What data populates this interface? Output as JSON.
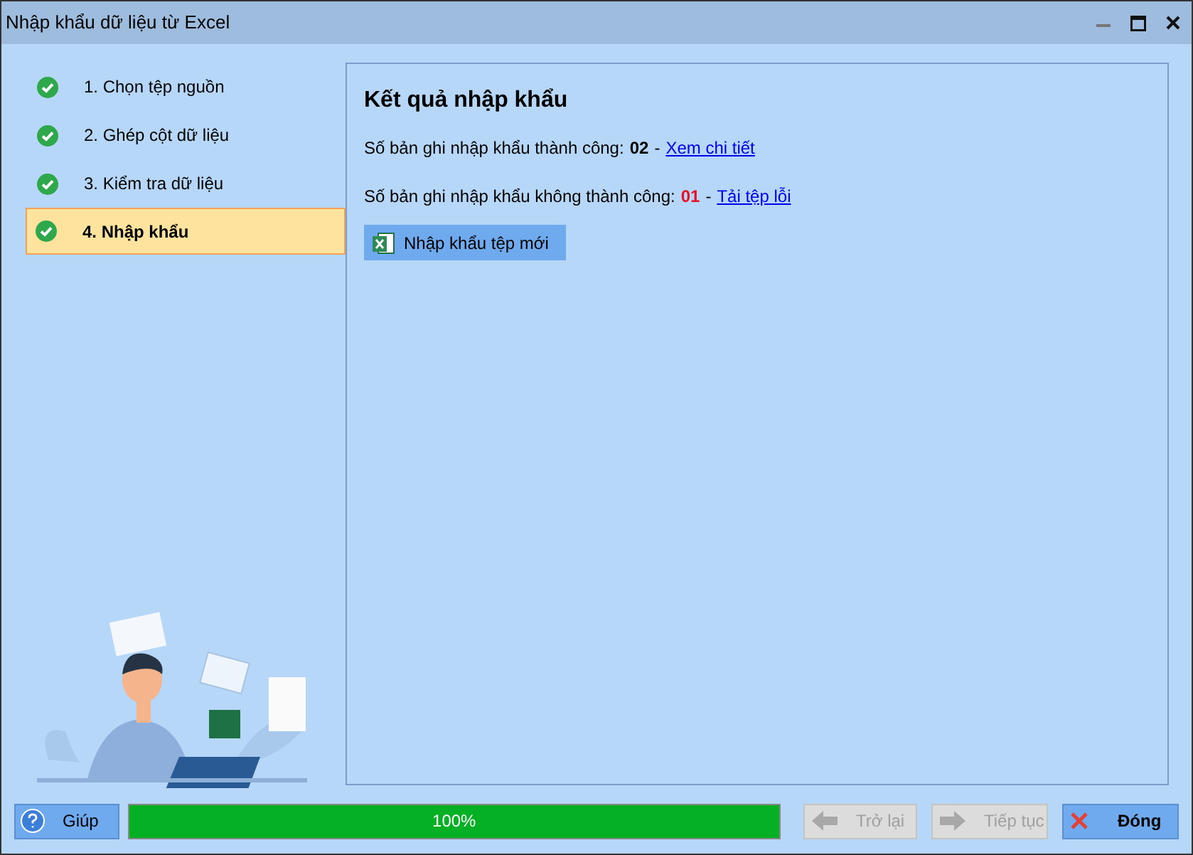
{
  "window": {
    "title": "Nhập khẩu dữ liệu từ Excel"
  },
  "steps": [
    {
      "label": "1. Chọn tệp nguồn",
      "done": true,
      "selected": false
    },
    {
      "label": "2. Ghép cột dữ liệu",
      "done": true,
      "selected": false
    },
    {
      "label": "3. Kiểm tra dữ liệu",
      "done": true,
      "selected": false
    },
    {
      "label": "4. Nhập khẩu",
      "done": true,
      "selected": true
    }
  ],
  "result": {
    "heading": "Kết quả nhập khẩu",
    "lines": [
      {
        "label": "Số bản ghi nhập khẩu thành công:",
        "count": "02",
        "color": "#000000",
        "separator": "-",
        "link": "Xem chi tiết"
      },
      {
        "label": "Số bản ghi nhập khẩu không thành công:",
        "count": "01",
        "color": "#e81123",
        "separator": "-",
        "link": "Tải tệp lỗi"
      }
    ],
    "import_button": "Nhập khẩu tệp mới"
  },
  "footer": {
    "help": "Giúp",
    "progress": {
      "level": 1,
      "reading": "100%"
    },
    "buttons": [
      {
        "label": "Trở lại",
        "kind": "back",
        "disabled": true
      },
      {
        "label": "Tiếp tục",
        "kind": "next",
        "disabled": true
      },
      {
        "label": "Đóng",
        "kind": "close",
        "disabled": false
      }
    ]
  }
}
